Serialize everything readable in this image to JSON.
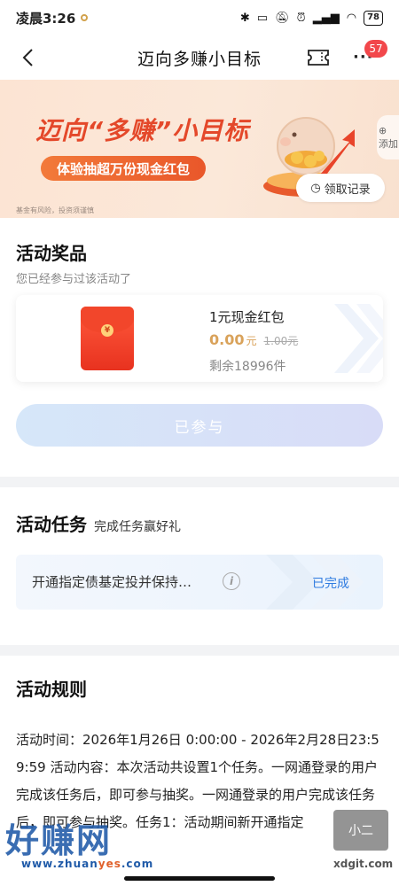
{
  "status_bar": {
    "time": "凌晨3:26",
    "battery": "78"
  },
  "header": {
    "title": "迈向多赚小目标",
    "badge_count": "57",
    "more_glyph": "···"
  },
  "banner": {
    "title": "迈向“多赚”小目标",
    "subtitle": "体验抽超万份现金红包",
    "risk_note": "基金有风险，投资须谨慎",
    "add_label": "添加",
    "record_button": "领取记录"
  },
  "prize_section": {
    "title": "活动奖品",
    "subtitle": "您已经参与过该活动了",
    "prize": {
      "name": "1元现金红包",
      "price": "0.00",
      "price_unit": "元",
      "original_price": "1.00元",
      "remaining": "剩余18996件"
    },
    "joined_button": "已参与"
  },
  "task_section": {
    "title": "活动任务",
    "subtitle": "完成任务赢好礼",
    "task": {
      "text": "开通指定债基定投并保持…",
      "status": "已完成"
    }
  },
  "rules_section": {
    "title": "活动规则",
    "body": "活动时间：2026年1月26日 0:00:00 - 2026年2月28日23:59:59 活动内容：本次活动共设置1个任务。一网通登录的用户完成该任务后，即可参与抽奖。一网通登录的用户完成该任务后，即可参与抽奖。任务1：活动期间新开通指定"
  },
  "watermarks": {
    "left_big": "好赚网",
    "left_small_a": "www.zhuan",
    "left_small_b": "yes",
    "left_small_c": ".com",
    "right_box": "小二",
    "right_site": "xdgit.com"
  },
  "colors": {
    "accent_orange": "#e4482a",
    "gold_price": "#d9a25a",
    "link_blue": "#2f7be0",
    "badge_red": "#f2474b"
  }
}
